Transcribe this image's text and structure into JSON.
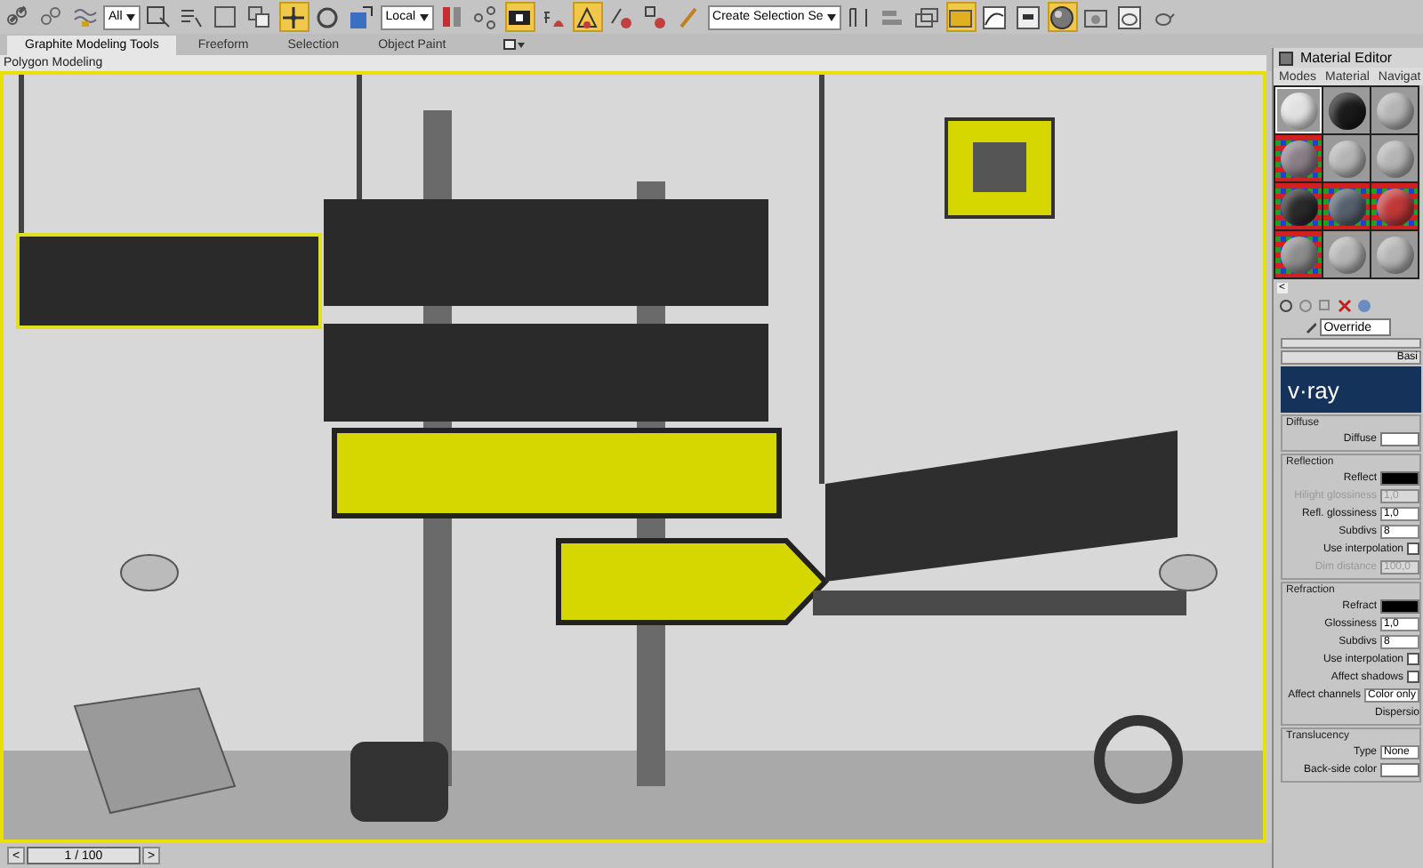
{
  "toolbar": [
    {
      "kind": "button",
      "selected": false
    },
    {
      "kind": "button",
      "selected": false
    },
    {
      "kind": "button",
      "selected": false
    },
    {
      "kind": "dropdown",
      "value": "All"
    },
    {
      "kind": "button",
      "selected": false
    },
    {
      "kind": "button",
      "selected": false
    },
    {
      "kind": "button",
      "selected": false
    },
    {
      "kind": "button",
      "selected": false
    },
    {
      "kind": "button",
      "selected": true
    },
    {
      "kind": "button",
      "selected": false
    },
    {
      "kind": "button",
      "selected": false
    },
    {
      "kind": "dropdown",
      "value": "Local"
    },
    {
      "kind": "button",
      "selected": false
    },
    {
      "kind": "button",
      "selected": false
    },
    {
      "kind": "button",
      "selected": true
    },
    {
      "kind": "button",
      "selected": false
    },
    {
      "kind": "button",
      "selected": true
    },
    {
      "kind": "button",
      "selected": false
    },
    {
      "kind": "button",
      "selected": false
    },
    {
      "kind": "button",
      "selected": false
    },
    {
      "kind": "dropdown",
      "value": "Create Selection Se"
    },
    {
      "kind": "button",
      "selected": false
    },
    {
      "kind": "button",
      "selected": false
    },
    {
      "kind": "button",
      "selected": false
    },
    {
      "kind": "button",
      "selected": true
    },
    {
      "kind": "button",
      "selected": false
    },
    {
      "kind": "button",
      "selected": false
    },
    {
      "kind": "button",
      "selected": true
    },
    {
      "kind": "button",
      "selected": false
    },
    {
      "kind": "button",
      "selected": false
    },
    {
      "kind": "button",
      "selected": false
    }
  ],
  "ribbon": {
    "tabs": [
      {
        "label": "Graphite Modeling Tools",
        "selected": true
      },
      {
        "label": "Freeform",
        "selected": false
      },
      {
        "label": "Selection",
        "selected": false
      },
      {
        "label": "Object Paint",
        "selected": false
      }
    ],
    "panel": "Polygon Modeling"
  },
  "timeline": {
    "frame": "1 / 100",
    "prev": "<",
    "next": ">"
  },
  "material_editor": {
    "title": "Material Editor",
    "menu": [
      "Modes",
      "Material",
      "Navigat"
    ],
    "slots": [
      {
        "color": "#e0e0e0",
        "checkered": false,
        "selected": true
      },
      {
        "color": "#1a1a1a",
        "checkered": false,
        "selected": false
      },
      {
        "color": "#b4b4b4",
        "checkered": false,
        "selected": false
      },
      {
        "color": "#8a7d86",
        "checkered": true,
        "selected": false
      },
      {
        "color": "#b4b4b4",
        "checkered": false,
        "selected": false
      },
      {
        "color": "#b4b4b4",
        "checkered": false,
        "selected": false
      },
      {
        "color": "#2a2a2a",
        "checkered": true,
        "selected": false
      },
      {
        "color": "#55606c",
        "checkered": true,
        "selected": false
      },
      {
        "color": "#c03838",
        "checkered": true,
        "selected": false
      },
      {
        "color": "#8c8c8c",
        "checkered": true,
        "selected": false
      },
      {
        "color": "#b4b4b4",
        "checkered": false,
        "selected": false
      },
      {
        "color": "#b4b4b4",
        "checkered": false,
        "selected": false
      }
    ],
    "scroll_arrow": "<",
    "material_name": "Override",
    "rollout": "Basi",
    "logo": "v·ray",
    "groups": [
      {
        "title": "Diffuse",
        "rows": [
          {
            "kind": "swatch",
            "label": "Diffuse",
            "color": "#ffffff"
          }
        ]
      },
      {
        "title": "Reflection",
        "rows": [
          {
            "kind": "swatch",
            "label": "Reflect",
            "color": "#000000"
          },
          {
            "kind": "spinner",
            "label": "Hilight glossiness",
            "value": "1,0",
            "disabled": true
          },
          {
            "kind": "spinner",
            "label": "Refl. glossiness",
            "value": "1,0",
            "disabled": false
          },
          {
            "kind": "spinner",
            "label": "Subdivs",
            "value": "8",
            "disabled": false
          },
          {
            "kind": "checkbox",
            "label": "Use interpolation",
            "checked": false
          },
          {
            "kind": "spinner",
            "label": "Dim distance",
            "value": "100,0",
            "disabled": true
          }
        ]
      },
      {
        "title": "Refraction",
        "rows": [
          {
            "kind": "swatch",
            "label": "Refract",
            "color": "#000000"
          },
          {
            "kind": "spinner",
            "label": "Glossiness",
            "value": "1,0",
            "disabled": false
          },
          {
            "kind": "spinner",
            "label": "Subdivs",
            "value": "8",
            "disabled": false
          },
          {
            "kind": "checkbox",
            "label": "Use interpolation",
            "checked": false
          },
          {
            "kind": "checkbox",
            "label": "Affect shadows",
            "checked": false
          },
          {
            "kind": "select",
            "label": "Affect channels",
            "value": "Color only"
          },
          {
            "kind": "text",
            "label": "Dispersio"
          }
        ]
      },
      {
        "title": "Translucency",
        "rows": [
          {
            "kind": "select",
            "label": "Type",
            "value": "None"
          },
          {
            "kind": "swatch",
            "label": "Back-side color",
            "color": "#ffffff"
          }
        ]
      }
    ]
  }
}
